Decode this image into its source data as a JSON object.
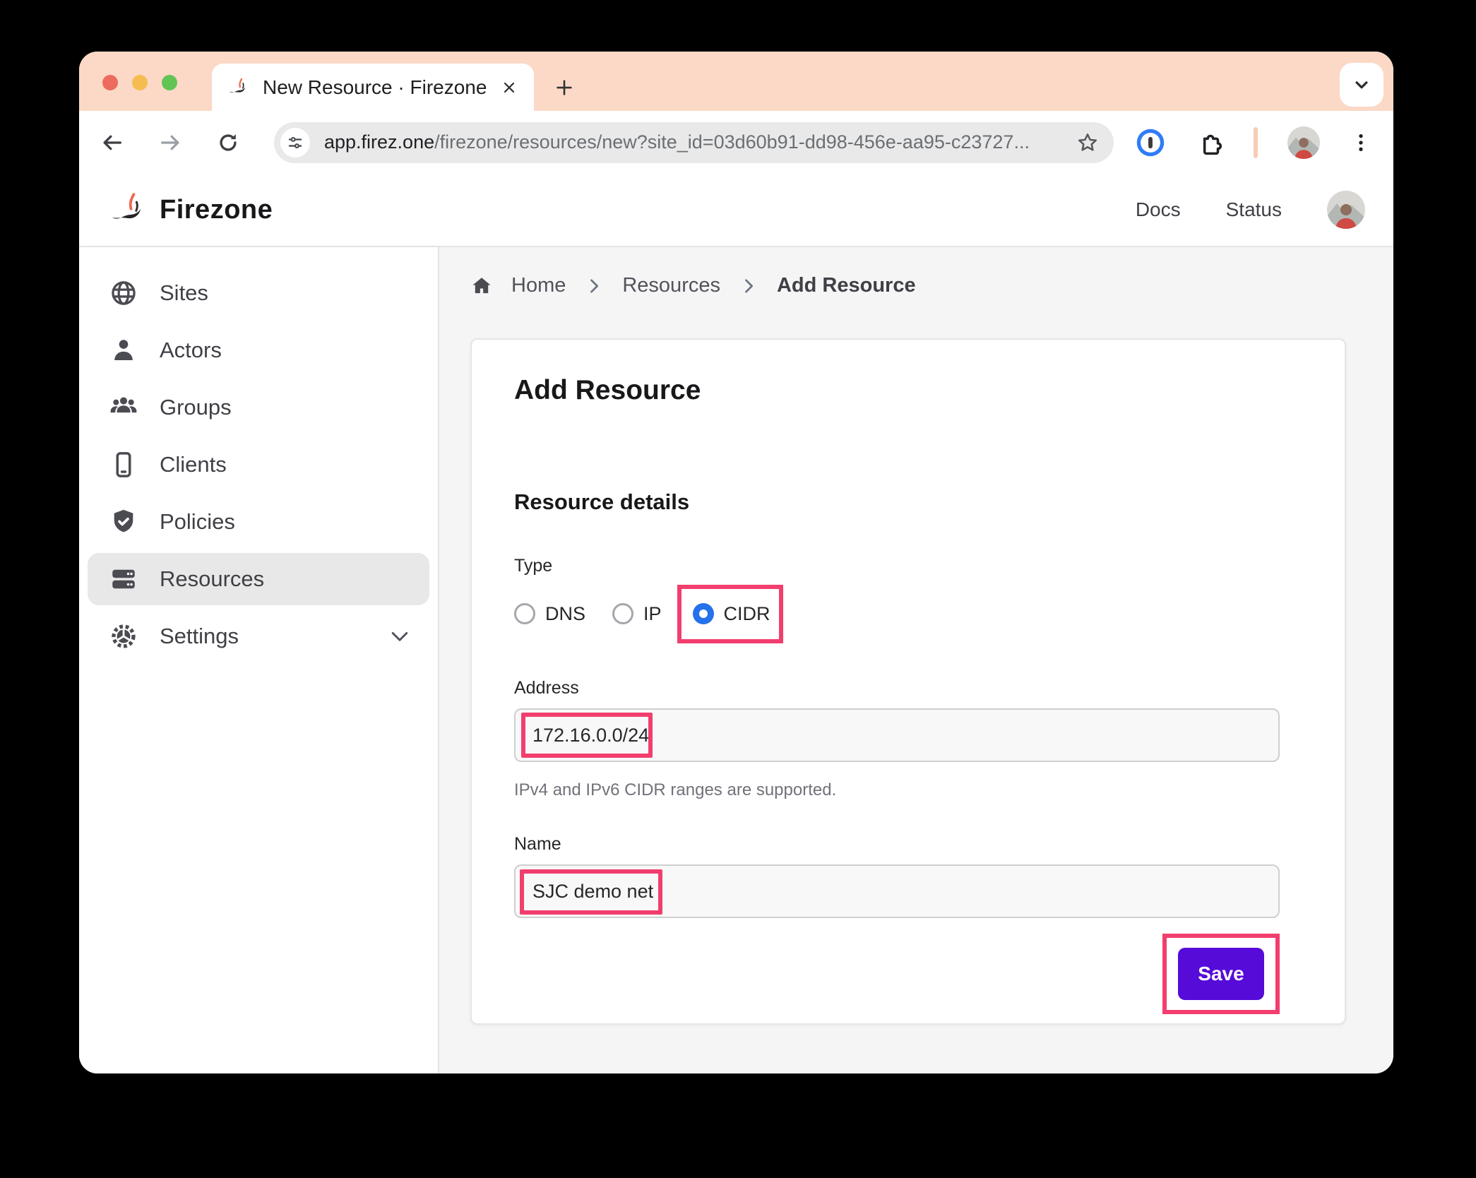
{
  "browser": {
    "tab_title": "New Resource · Firezone",
    "url_domain": "app.firez.one",
    "url_path": "/firezone/resources/new?site_id=03d60b91-dd98-456e-aa95-c23727..."
  },
  "header": {
    "brand": "Firezone",
    "nav": [
      {
        "label": "Docs"
      },
      {
        "label": "Status"
      }
    ]
  },
  "sidebar": {
    "active_item": "Resources",
    "items": [
      {
        "label": "Sites",
        "icon": "globe-icon"
      },
      {
        "label": "Actors",
        "icon": "person-icon"
      },
      {
        "label": "Groups",
        "icon": "users-icon"
      },
      {
        "label": "Clients",
        "icon": "mobile-icon"
      },
      {
        "label": "Policies",
        "icon": "shield-check-icon"
      },
      {
        "label": "Resources",
        "icon": "server-stack-icon"
      },
      {
        "label": "Settings",
        "icon": "gear-icon"
      }
    ]
  },
  "breadcrumb": {
    "items": [
      "Home",
      "Resources",
      "Add Resource"
    ]
  },
  "form": {
    "title": "Add Resource",
    "section_title": "Resource details",
    "type_label": "Type",
    "type_options": [
      {
        "label": "DNS",
        "selected": false
      },
      {
        "label": "IP",
        "selected": false
      },
      {
        "label": "CIDR",
        "selected": true
      }
    ],
    "address_label": "Address",
    "address_value": "172.16.0.0/24",
    "address_help": "IPv4 and IPv6 CIDR ranges are supported.",
    "name_label": "Name",
    "name_value": "SJC demo net",
    "save_label": "Save"
  },
  "icons": {
    "globe-icon": "wireframe globe",
    "person-icon": "single person silhouette",
    "users-icon": "three people group",
    "mobile-icon": "smartphone outline",
    "shield-check-icon": "shield with checkmark",
    "server-stack-icon": "stacked servers",
    "gear-icon": "cog wheel",
    "home-icon": "house",
    "chevron-right-icon": "›",
    "chevron-down-icon": "⌄",
    "star-icon": "☆ bookmark",
    "puzzle-icon": "extensions puzzle piece",
    "tune-icon": "url site controls sliders",
    "back-icon": "←",
    "forward-icon": "→",
    "reload-icon": "⟳",
    "plus-icon": "+",
    "close-icon": "✕",
    "kebab-icon": "⋮ menu",
    "onepassword-icon": "blue circle password manager"
  },
  "colors": {
    "annotation_pink": "#F23E6E",
    "save_purple": "#560BD8",
    "radio_blue": "#2570EB",
    "tabstrip_peach": "#FBD9C6"
  }
}
